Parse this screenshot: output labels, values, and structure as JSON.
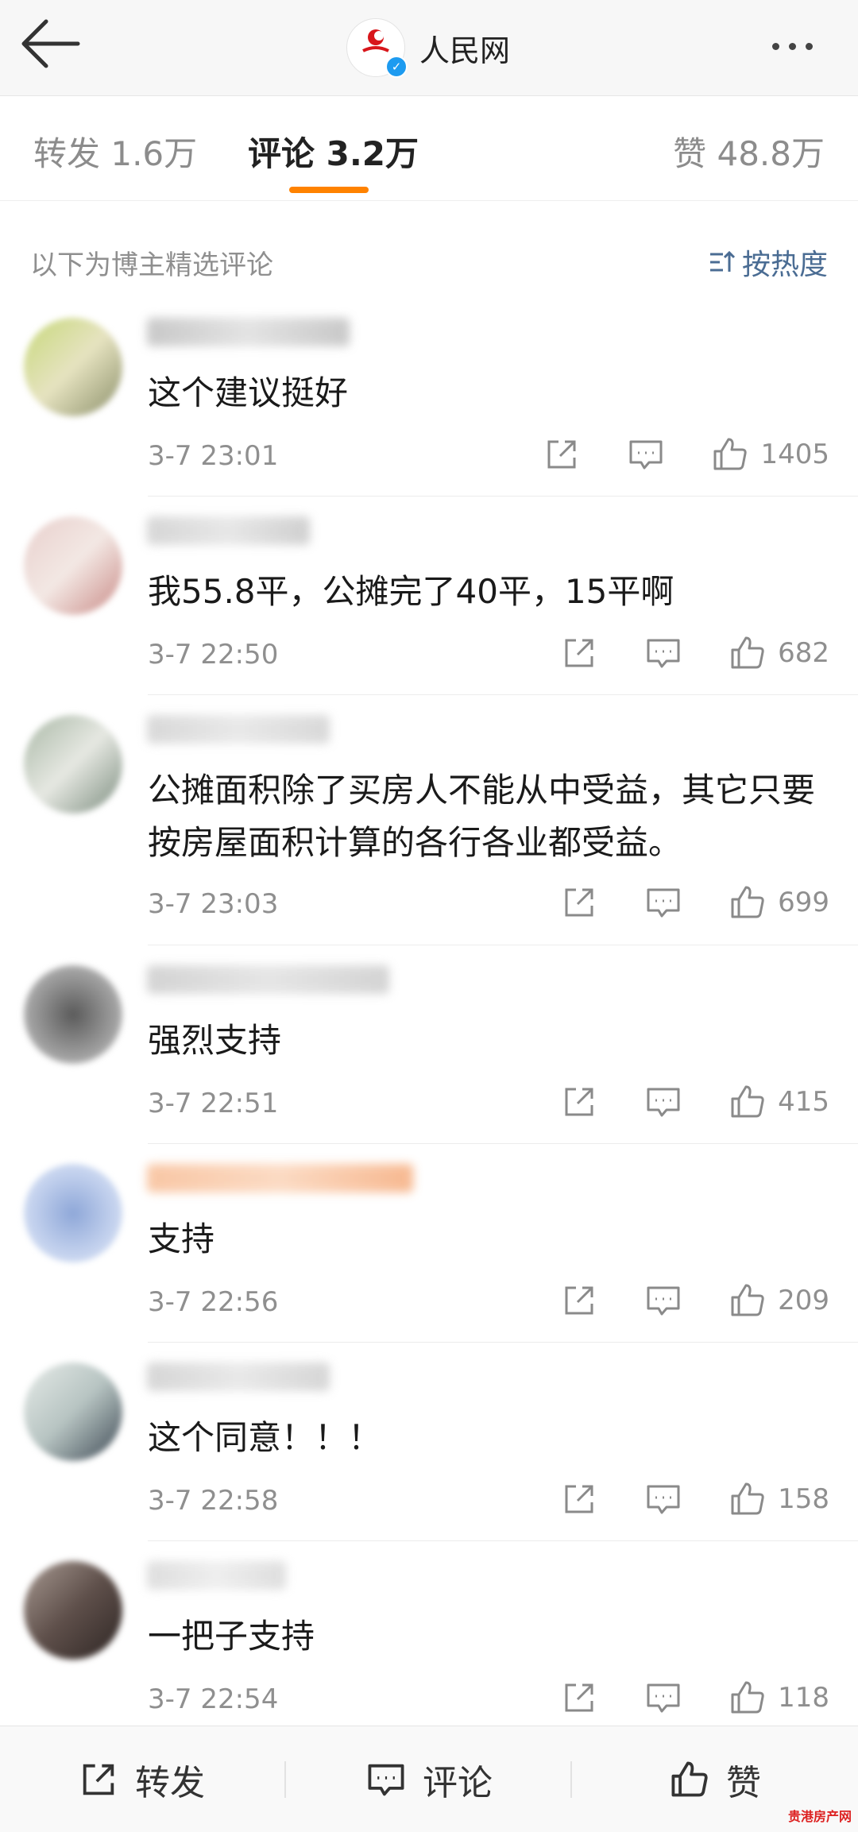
{
  "header": {
    "title": "人民网",
    "logo_text": "人民网",
    "verified_mark": "✓"
  },
  "tabs": [
    {
      "label": "转发 1.6万"
    },
    {
      "label": "评论 3.2万"
    },
    {
      "label": "赞 48.8万"
    }
  ],
  "section": {
    "label": "以下为博主精选评论",
    "sort_label": "按热度"
  },
  "comments": [
    {
      "text": "这个建议挺好",
      "time": "3-7 23:01",
      "likes": "1405"
    },
    {
      "text": "我55.8平，公摊完了40平，15平啊",
      "time": "3-7 22:50",
      "likes": "682"
    },
    {
      "text": "公摊面积除了买房人不能从中受益，其它只要按房屋面积计算的各行各业都受益。",
      "time": "3-7 23:03",
      "likes": "699"
    },
    {
      "text": "强烈支持",
      "time": "3-7 22:51",
      "likes": "415"
    },
    {
      "text": "支持",
      "time": "3-7 22:56",
      "likes": "209"
    },
    {
      "text": "这个同意！！！",
      "time": "3-7 22:58",
      "likes": "158"
    },
    {
      "text": "一把子支持",
      "time": "3-7 22:54",
      "likes": "118"
    }
  ],
  "bottom_bar": {
    "repost_label": "转发",
    "comment_label": "评论",
    "like_label": "赞"
  },
  "watermark": "贵港房产网",
  "colors": {
    "accent": "#ff8200",
    "link": "#4a6c93",
    "muted": "#8f8f8f"
  }
}
